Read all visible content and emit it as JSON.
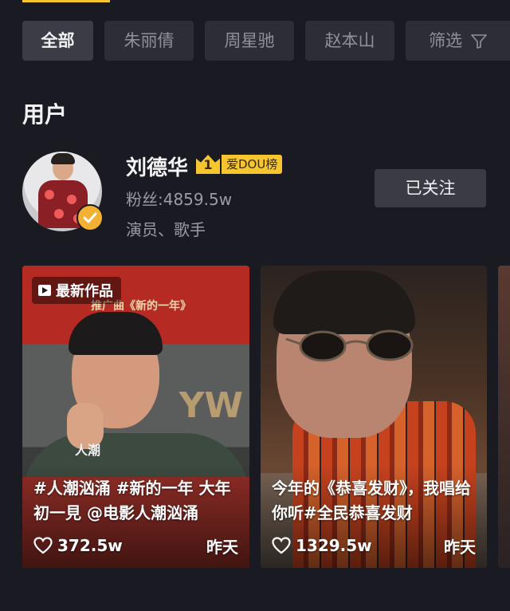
{
  "filters": {
    "chips": [
      "全部",
      "朱丽倩",
      "周星驰",
      "赵本山"
    ],
    "filter_label": "筛选"
  },
  "section": {
    "title": "用户"
  },
  "user": {
    "name": "刘德华",
    "rank_number": "1",
    "rank_label": "爱DOU榜",
    "fans": "粉丝:4859.5w",
    "roles": "演员、歌手",
    "follow_label": "已关注"
  },
  "videos": [
    {
      "badge": "最新作品",
      "poster_subtitle": "推广曲《新的一年》",
      "wall_text": "YW",
      "renchao": "人潮",
      "description": "#人潮汹涌 #新的一年 大年初一見 @电影人潮汹涌",
      "likes": "372.5w",
      "time": "昨天"
    },
    {
      "description": "今年的《恭喜发财》，我唱给你听#全民恭喜发财",
      "likes": "1329.5w",
      "time": "昨天"
    }
  ],
  "colors": {
    "accent": "#f7c62f",
    "background": "#1a1b22",
    "chip": "#2c2d35"
  }
}
